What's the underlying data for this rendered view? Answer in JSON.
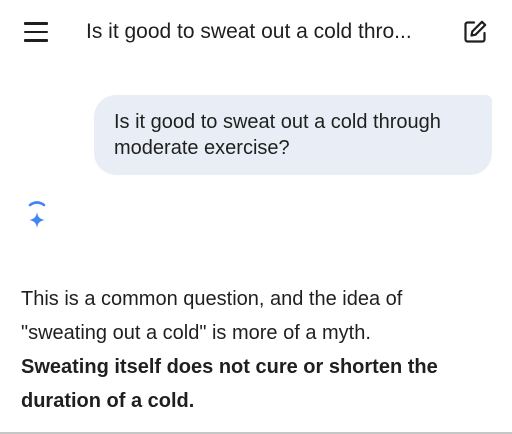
{
  "header": {
    "title": "Is it good to sweat out a cold thro...",
    "menu_icon": "hamburger-menu-icon",
    "edit_icon": "new-chat-edit-icon"
  },
  "conversation": {
    "user_message_line1": "Is it good to sweat out a cold through",
    "user_message_line2": "moderate exercise?",
    "assistant_icon": "gemini-spark-icon",
    "response_line1": "This is a common question, and the idea of",
    "response_line2": "\"sweating out a cold\" is more of a myth.",
    "response_bold_line1": "Sweating itself does not cure or shorten the",
    "response_bold_line2": "duration of a cold."
  },
  "colors": {
    "bubble": "#e9eef6",
    "text": "#1f1f1f",
    "spark_blue": "#4285f4"
  }
}
